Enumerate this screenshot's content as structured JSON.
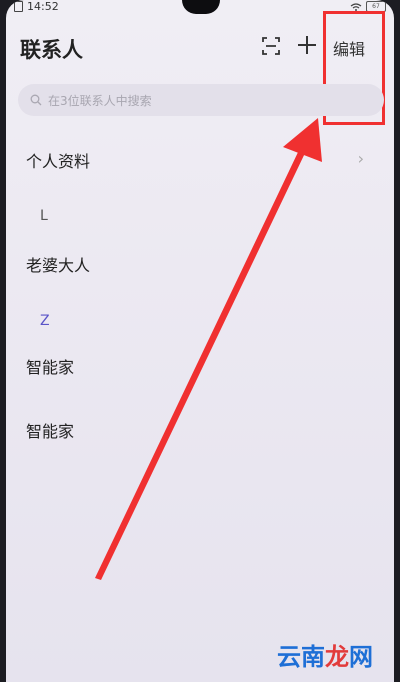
{
  "status_bar": {
    "time": "14:52",
    "battery_text": "67"
  },
  "header": {
    "title": "联系人",
    "add_icon": "plus-icon",
    "scan_icon": "scan-icon",
    "edit_label": "编辑"
  },
  "search": {
    "placeholder": "在3位联系人中搜索"
  },
  "profile": {
    "label": "个人资料",
    "chevron": "›"
  },
  "sections": [
    {
      "letter": "L",
      "contacts": [
        "老婆大人"
      ]
    },
    {
      "letter": "Z",
      "contacts": [
        "智能家",
        "智能家"
      ]
    }
  ],
  "annotation": {
    "highlight_color": "#f03030",
    "arrow_color": "#f03030"
  },
  "watermark": {
    "chars": [
      "云",
      "南",
      "龙",
      "网"
    ]
  },
  "colors": {
    "section_z_color": "#5a54c8"
  }
}
